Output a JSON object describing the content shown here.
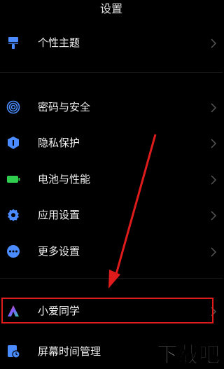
{
  "header": {
    "title": "设置"
  },
  "items": [
    {
      "label": "个性主题",
      "icon": "theme-brush-icon"
    },
    {
      "label": "密码与安全",
      "icon": "fingerprint-icon"
    },
    {
      "label": "隐私保护",
      "icon": "privacy-shield-icon"
    },
    {
      "label": "电池与性能",
      "icon": "battery-icon"
    },
    {
      "label": "应用设置",
      "icon": "gear-icon"
    },
    {
      "label": "更多设置",
      "icon": "more-dots-icon"
    },
    {
      "label": "小爱同学",
      "icon": "xiaoai-assistant-icon"
    },
    {
      "label": "屏幕时间管理",
      "icon": "screen-time-icon"
    }
  ],
  "watermark": {
    "text": "下载吧"
  },
  "colors": {
    "background": "#000000",
    "highlight": "#e01b1b",
    "icon_blue": "#4a8cff",
    "battery_green": "#2fce4e"
  }
}
